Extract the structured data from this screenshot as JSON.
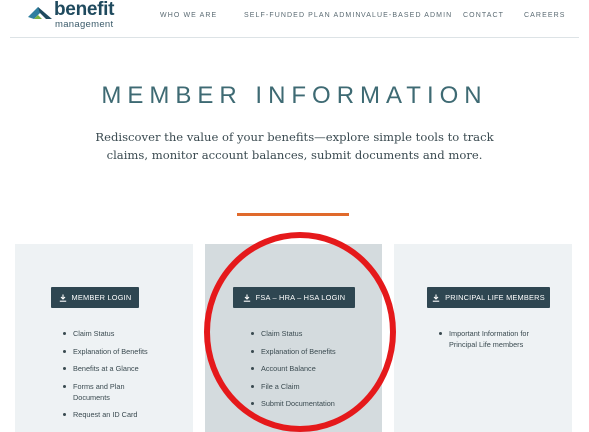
{
  "logo": {
    "name": "benefit",
    "tagline": "management",
    "icon": "logo-chevron-icon"
  },
  "nav": [
    {
      "label": "WHO WE ARE"
    },
    {
      "label": "SELF-FUNDED PLAN ADMIN"
    },
    {
      "label": "VALUE-BASED ADMIN"
    },
    {
      "label": "CONTACT"
    },
    {
      "label": "CAREERS"
    }
  ],
  "hero": {
    "title": "MEMBER INFORMATION",
    "subtitle": "Rediscover the value of your benefits—explore simple tools to track claims, monitor account balances, submit documents and more."
  },
  "cards": [
    {
      "button": "MEMBER LOGIN",
      "icon": "download-icon",
      "items": [
        "Claim Status",
        "Explanation of Benefits",
        "Benefits at a Glance",
        "Forms and Plan Documents",
        "Request an ID Card"
      ]
    },
    {
      "button": "FSA – HRA – HSA LOGIN",
      "icon": "download-icon",
      "items": [
        "Claim Status",
        "Explanation of Benefits",
        "Account Balance",
        "File a Claim",
        "Submit Documentation"
      ]
    },
    {
      "button": "PRINCIPAL LIFE MEMBERS",
      "icon": "download-icon",
      "items": [
        "Important Information for Principal Life members"
      ]
    }
  ],
  "colors": {
    "accent": "#e06a2c",
    "title": "#3e6a73",
    "button": "#2e4651",
    "annotation": "#e5191b"
  }
}
